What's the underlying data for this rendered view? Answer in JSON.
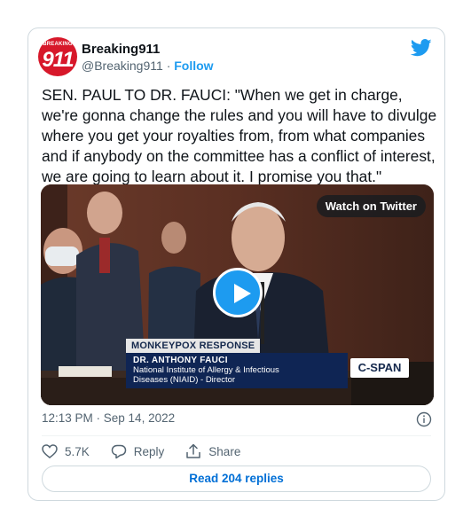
{
  "account": {
    "avatar_text_small": "BREAKING",
    "avatar_text_big": "911",
    "name": "Breaking911",
    "handle": "@Breaking911",
    "separator": "·",
    "follow_label": "Follow"
  },
  "tweet": {
    "text": "SEN. PAUL TO DR. FAUCI: \"When we get in charge, we're gonna change the rules and you will have to divulge where you get your royalties from, from what companies and if anybody on the committee has a conflict of interest, we are going to learn about it. I promise you that.\"",
    "timestamp": "12:13 PM · Sep 14, 2022"
  },
  "media": {
    "watch_label": "Watch on Twitter",
    "chyron_top": "MONKEYPOX RESPONSE",
    "chyron_name": "DR. ANTHONY FAUCI",
    "chyron_line1": "National Institute of Allergy & Infectious",
    "chyron_line2": "Diseases (NIAID) - Director",
    "network": "C-SPAN"
  },
  "actions": {
    "like_count": "5.7K",
    "reply_label": "Reply",
    "share_label": "Share",
    "read_replies": "Read 204 replies"
  },
  "colors": {
    "twitter_blue": "#1d9bf0",
    "link_blue": "#006fd6",
    "muted": "#536471",
    "avatar_red": "#d7182a"
  },
  "icons": [
    "twitter-bird-icon",
    "info-icon",
    "heart-icon",
    "reply-bubble-icon",
    "share-upload-icon",
    "play-icon"
  ]
}
